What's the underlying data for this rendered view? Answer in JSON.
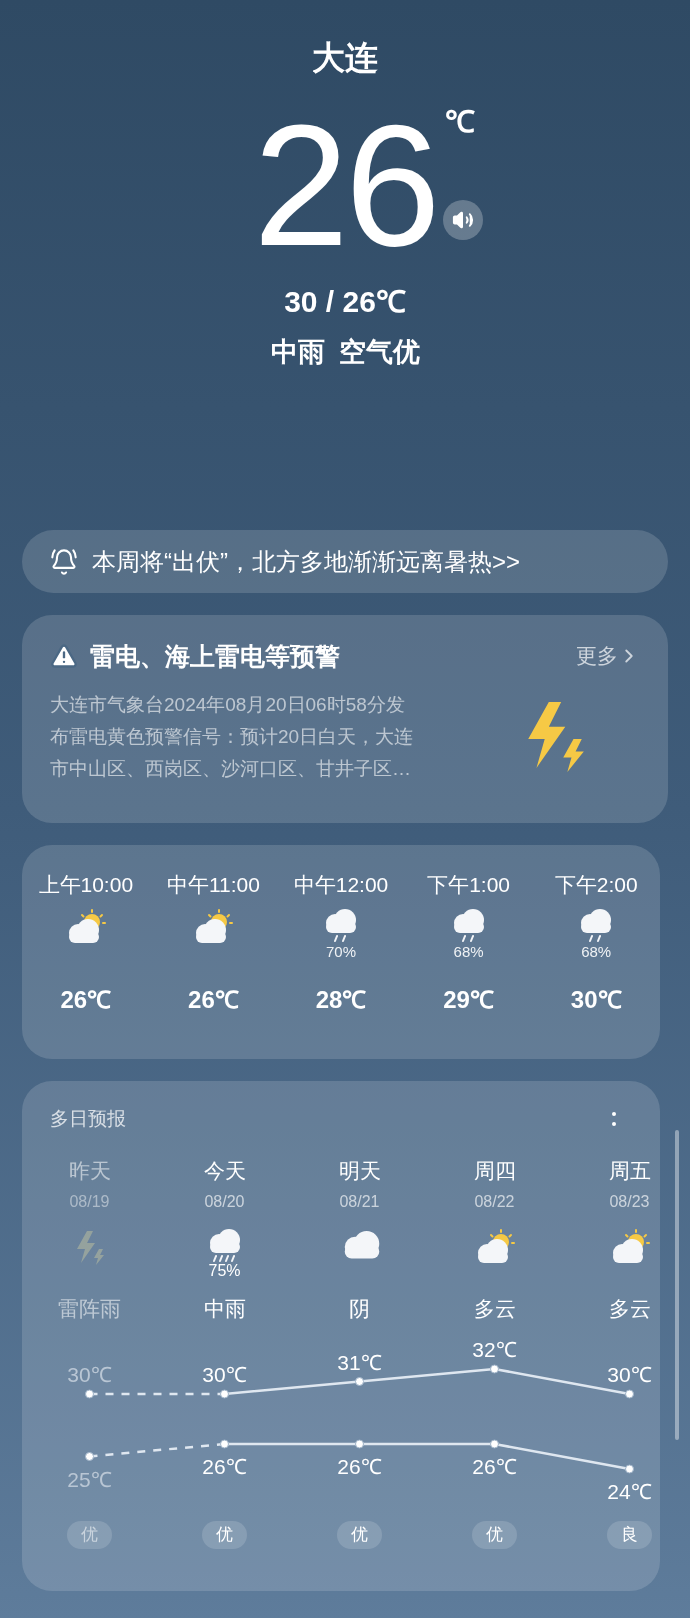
{
  "city": "大连",
  "temperature": "26",
  "unit": "℃",
  "range": "30 / 26℃",
  "condition": "中雨",
  "air": "空气优",
  "news": {
    "text": "本周将“出伏”，北方多地渐渐远离暑热>>"
  },
  "alert": {
    "title": "雷电、海上雷电等预警",
    "more": "更多",
    "lines": [
      "大连市气象台2024年08月20日06时58分发",
      "布雷电黄色预警信号：预计20日白天，大连",
      "市中山区、西岗区、沙河口区、甘井子区…"
    ]
  },
  "hourly": [
    {
      "time": "上午10:00",
      "kind": "partly-cloudy",
      "temp": "26℃"
    },
    {
      "time": "中午11:00",
      "kind": "partly-cloudy",
      "temp": "26℃"
    },
    {
      "time": "中午12:00",
      "kind": "rain",
      "chance": "70%",
      "temp": "28℃"
    },
    {
      "time": "下午1:00",
      "kind": "rain",
      "chance": "68%",
      "temp": "29℃"
    },
    {
      "time": "下午2:00",
      "kind": "rain",
      "chance": "68%",
      "temp": "30℃"
    }
  ],
  "daily": {
    "title": "多日预报",
    "days": [
      {
        "name": "昨天",
        "date": "08/19",
        "kind": "thunder",
        "condition": "雷阵雨",
        "aqi": "优",
        "past": true
      },
      {
        "name": "今天",
        "date": "08/20",
        "kind": "heavy-rain",
        "chance": "75%",
        "condition": "中雨",
        "aqi": "优",
        "past": false
      },
      {
        "name": "明天",
        "date": "08/21",
        "kind": "cloudy",
        "condition": "阴",
        "aqi": "优",
        "past": false
      },
      {
        "name": "周四",
        "date": "08/22",
        "kind": "partly-cloudy",
        "condition": "多云",
        "aqi": "优",
        "past": false
      },
      {
        "name": "周五",
        "date": "08/23",
        "kind": "partly-cloudy",
        "condition": "多云",
        "aqi": "良",
        "past": false
      }
    ],
    "chart_data": {
      "type": "line",
      "categories": [
        null,
        null,
        null,
        null,
        null
      ],
      "series": [
        {
          "color": "#dfe7f0",
          "line_style": "dashed",
          "marker": "circle",
          "values": [
            30,
            30,
            31,
            32,
            30
          ],
          "value_labels": [
            "30℃",
            "30℃",
            "31℃",
            "32℃",
            "30℃"
          ]
        },
        {
          "color": "#dfe7f0",
          "line_style": "dashed",
          "marker": "circle",
          "values": [
            25,
            26,
            26,
            26,
            24
          ],
          "value_labels": [
            "25℃",
            "26℃",
            "26℃",
            "26℃",
            "24℃"
          ]
        }
      ]
    }
  }
}
